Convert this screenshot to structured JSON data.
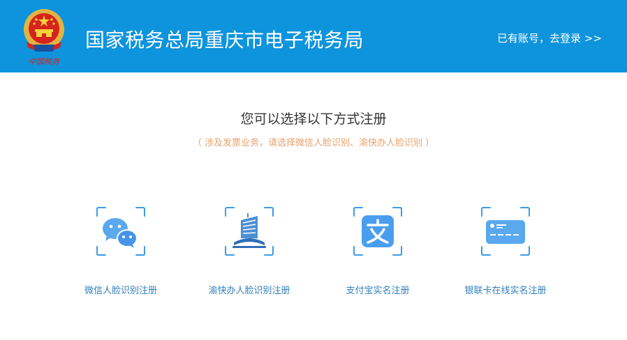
{
  "header": {
    "title": "国家税务总局重庆市电子税务局",
    "login_link": "已有账号，去登录 >>",
    "emblem_text": "中国税务"
  },
  "main": {
    "heading": "您可以选择以下方式注册",
    "note": "（ 涉及发票业务，请选择微信人脸识别、渝快办人脸识别 ）",
    "options": [
      {
        "label": "微信人脸识别注册",
        "icon": "wechat-icon"
      },
      {
        "label": "渝快办人脸识别注册",
        "icon": "building-icon"
      },
      {
        "label": "支付宝实名注册",
        "icon": "alipay-icon"
      },
      {
        "label": "银联卡在线实名注册",
        "icon": "bank-card-icon"
      }
    ]
  },
  "colors": {
    "header_bg": "#0e94dd",
    "accent_blue": "#3b9bea",
    "note_orange": "#e8a16a",
    "label_blue": "#2f7fbf"
  }
}
